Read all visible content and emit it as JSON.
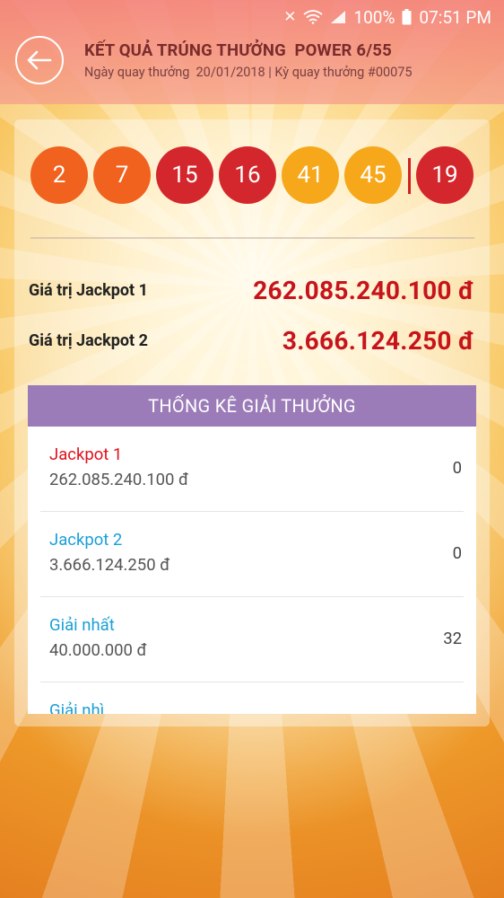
{
  "status_bar": {
    "battery": "100%",
    "time": "07:51 PM"
  },
  "header": {
    "title": "KẾT QUẢ TRÚNG THƯỞNG  POWER 6/55",
    "subtitle": "Ngày quay thưởng  20/01/2018 | Kỳ quay thưởng #00075"
  },
  "balls": [
    {
      "value": "2",
      "color": "#f0621e"
    },
    {
      "value": "7",
      "color": "#f0621e"
    },
    {
      "value": "15",
      "color": "#d3272d"
    },
    {
      "value": "16",
      "color": "#d3272d"
    },
    {
      "value": "41",
      "color": "#f6a81a"
    },
    {
      "value": "45",
      "color": "#f6a81a"
    }
  ],
  "power_ball": {
    "value": "19",
    "color": "#d3272d"
  },
  "jackpots": [
    {
      "label": "Giá trị Jackpot 1",
      "value": "262.085.240.100 đ"
    },
    {
      "label": "Giá trị Jackpot 2",
      "value": "3.666.124.250 đ"
    }
  ],
  "stats": {
    "title": "THỐNG KÊ GIẢI THƯỞNG",
    "rows": [
      {
        "name": "Jackpot 1",
        "amount": "262.085.240.100 đ",
        "count": "0",
        "name_color": "#e0111b"
      },
      {
        "name": "Jackpot 2",
        "amount": "3.666.124.250 đ",
        "count": "0",
        "name_color": "#1a9fd8"
      },
      {
        "name": "Giải nhất",
        "amount": "40.000.000 đ",
        "count": "32",
        "name_color": "#1a9fd8"
      },
      {
        "name": "Giải nhì",
        "amount": "",
        "count": "",
        "name_color": "#1a9fd8"
      }
    ]
  }
}
